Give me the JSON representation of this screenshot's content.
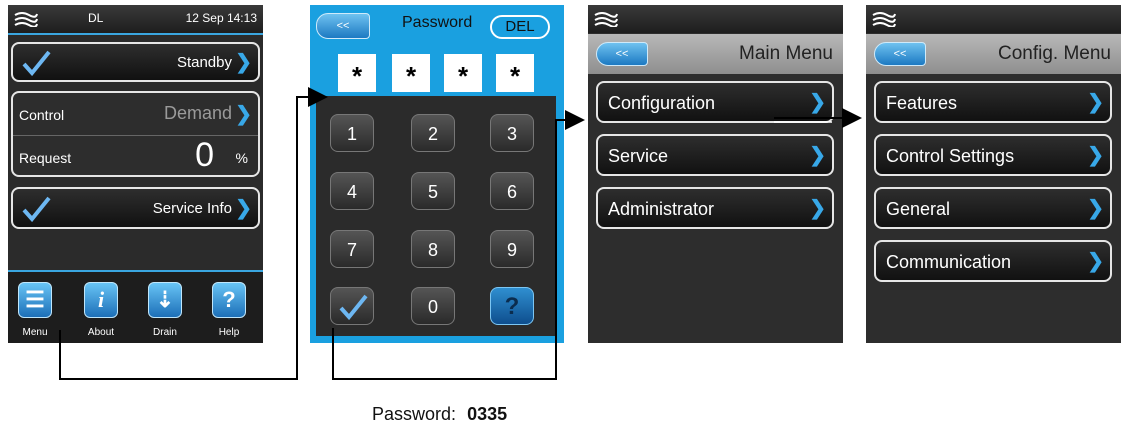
{
  "screen1": {
    "status_left": "DL",
    "status_right": "12 Sep 14:13",
    "standby_label": "Standby",
    "control_label": "Control",
    "control_value": "Demand",
    "request_label": "Request",
    "request_value": "0",
    "request_unit": "%",
    "service_info_label": "Service Info",
    "apps": [
      {
        "label": "Menu",
        "icon": "document-icon"
      },
      {
        "label": "About",
        "icon": "info-icon"
      },
      {
        "label": "Drain",
        "icon": "drain-icon"
      },
      {
        "label": "Help",
        "icon": "help-icon"
      }
    ]
  },
  "screen2": {
    "back_label": "<<",
    "title": "Password",
    "del_label": "DEL",
    "masked": [
      "*",
      "*",
      "*",
      "*"
    ],
    "keys": [
      "1",
      "2",
      "3",
      "4",
      "5",
      "6",
      "7",
      "8",
      "9",
      "0"
    ],
    "help_glyph": "?"
  },
  "screen3": {
    "back_label": "<<",
    "title": "Main Menu",
    "items": [
      "Configuration",
      "Service",
      "Administrator"
    ]
  },
  "screen4": {
    "back_label": "<<",
    "title": "Config. Menu",
    "items": [
      "Features",
      "Control Settings",
      "General",
      "Communication"
    ]
  },
  "caption": {
    "label": "Password:",
    "value": "0335"
  },
  "colors": {
    "accent_blue": "#38a8e8",
    "frame_blue": "#1aa0e0"
  }
}
